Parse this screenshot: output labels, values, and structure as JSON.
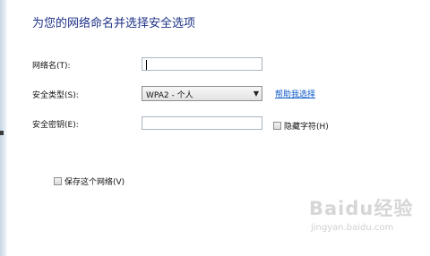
{
  "dialog": {
    "title": "为您的网络命名并选择安全选项"
  },
  "form": {
    "network_name_label": "网络名(T):",
    "network_name_value": "",
    "security_type_label": "安全类型(S):",
    "security_type_value": "WPA2 - 个人",
    "help_link": "帮助我选择",
    "security_key_label": "安全密钥(E):",
    "security_key_value": "",
    "hide_chars_label": "隐藏字符(H)",
    "save_network_label": "保存这个网络(V)"
  },
  "watermark": {
    "main": "Baidu经验",
    "sub": "jingyan.baidu.com"
  },
  "colors": {
    "title": "#1e3287",
    "link": "#0a58c7"
  },
  "icons": {
    "dropdown": "chevron-down-icon"
  }
}
